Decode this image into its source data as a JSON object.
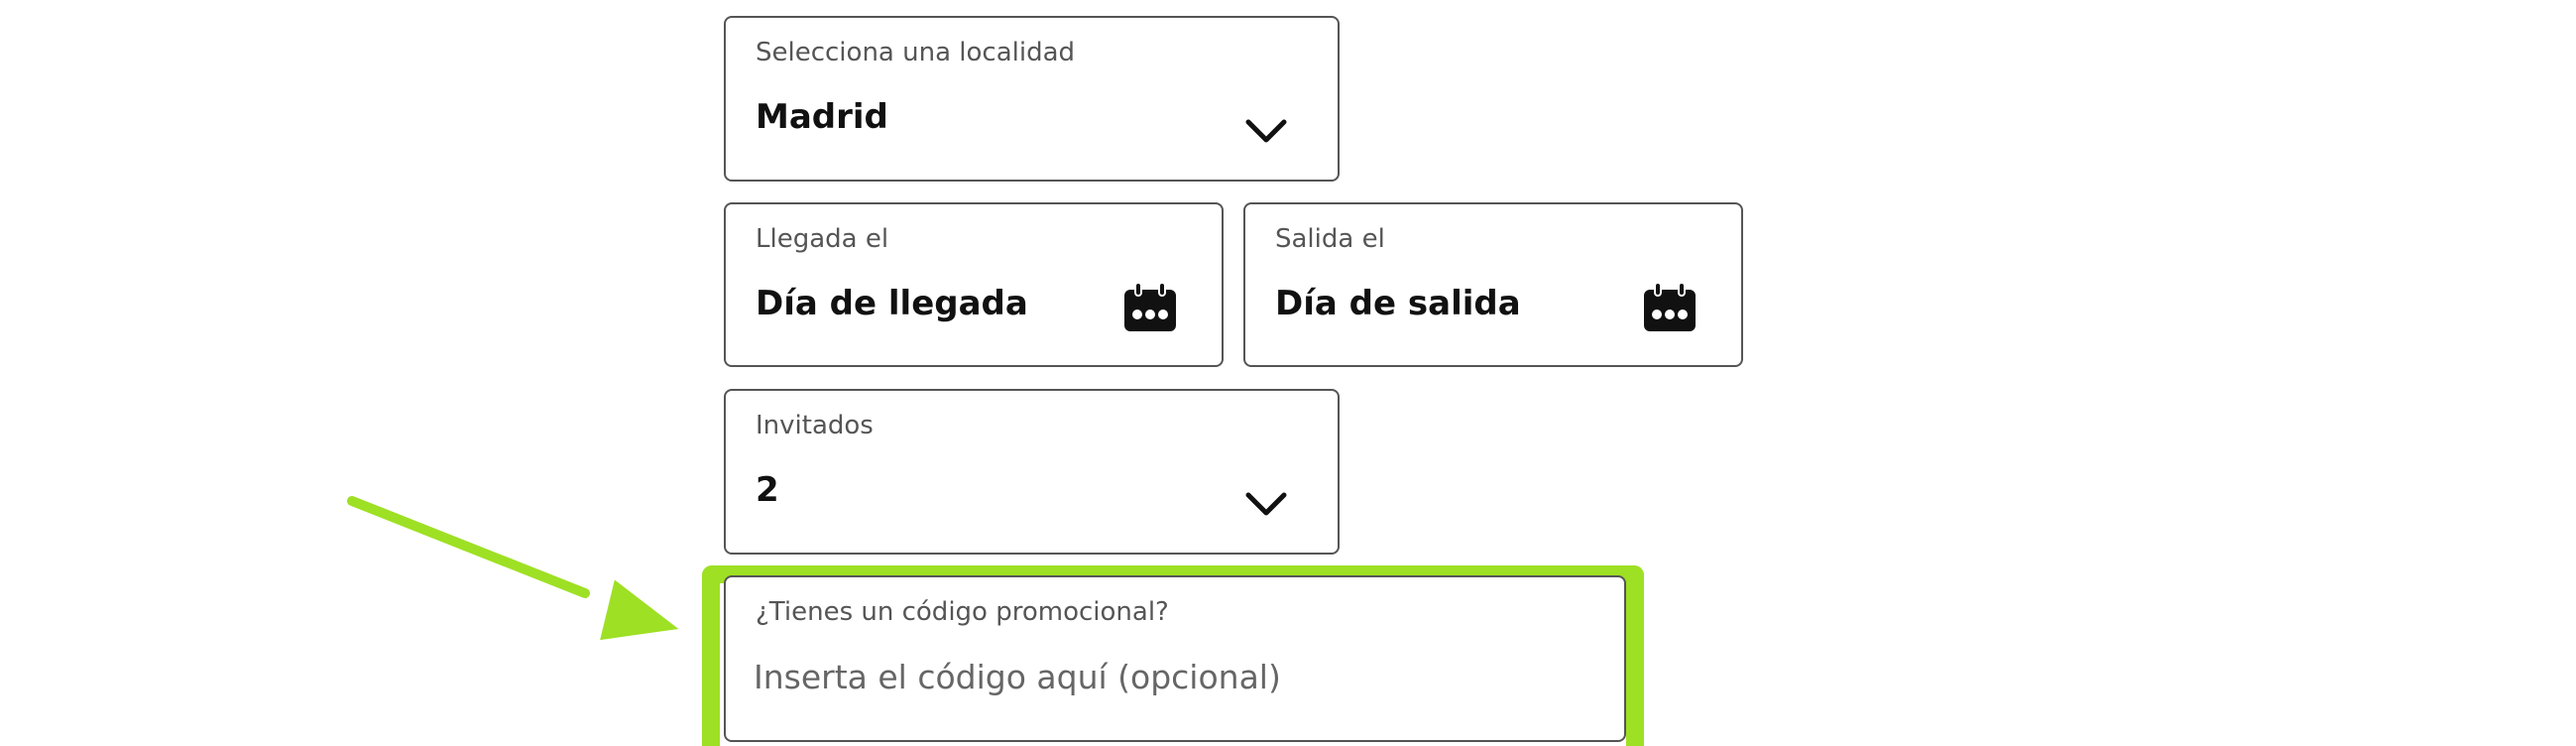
{
  "form": {
    "localidad": {
      "label": "Selecciona una localidad",
      "value": "Madrid",
      "icon": "chevron-down-icon"
    },
    "llegada": {
      "label": "Llegada el",
      "value": "Día de llegada",
      "icon": "calendar-icon"
    },
    "salida": {
      "label": "Salida el",
      "value": "Día de salida",
      "icon": "calendar-icon"
    },
    "invitados": {
      "label": "Invitados",
      "value": "2",
      "icon": "chevron-down-icon"
    },
    "promo": {
      "label": "¿Tienes un código promocional?",
      "value": "",
      "placeholder": "Inserta el código aquí (opcional)"
    }
  },
  "annotation": {
    "highlight_color": "#9ee024",
    "arrow_icon": "arrow-annotation-icon"
  }
}
